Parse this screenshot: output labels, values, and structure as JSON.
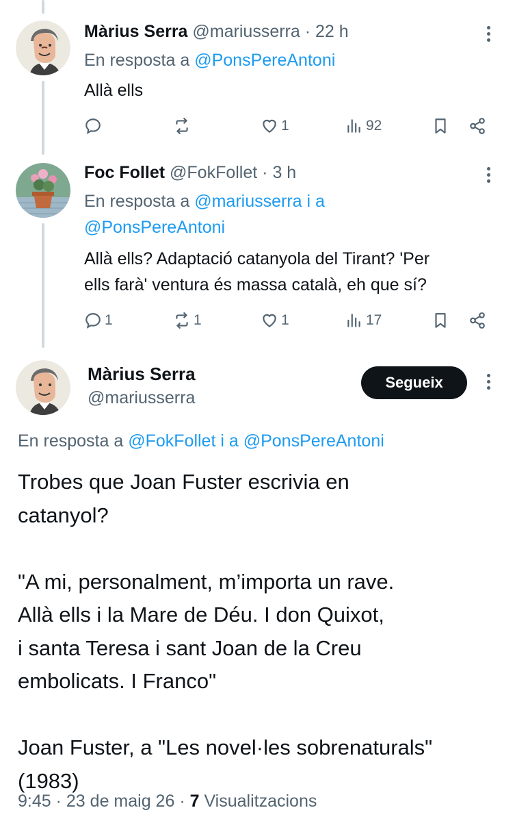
{
  "tweets": [
    {
      "author": "Màrius Serra",
      "handle": "@mariusserra",
      "time": "22 h",
      "reply_prefix": "En resposta a",
      "reply_mention": "@PonsPereAntoni",
      "text": "Allà ells",
      "actions": {
        "replies": "",
        "retweets": "",
        "likes": "1",
        "views": "92"
      }
    },
    {
      "author": "Foc Follet",
      "handle": "@FokFollet",
      "time": "3 h",
      "reply_prefix": "En resposta a",
      "reply_mention_1": "@mariusserra",
      "reply_conj": "i a",
      "reply_mention_2": "@PonsPereAntoni",
      "text_line_1": "Allà ells? Adaptació catanyola del Tirant? 'Per",
      "text_line_2": "ells farà' ventura és massa català, eh que sí?",
      "actions": {
        "replies": "1",
        "retweets": "1",
        "likes": "1",
        "views": "17"
      }
    }
  ],
  "main": {
    "author": "Màrius Serra",
    "handle": "@mariusserra",
    "follow_label": "Segueix",
    "reply_prefix": "En resposta a",
    "reply_mention_1": "@FokFollet",
    "reply_conj": "i a",
    "reply_mention_2": "@PonsPereAntoni",
    "paragraph_1": "Trobes que Joan Fuster escrivia en\ncatanyol?",
    "paragraph_2": "\"A mi, personalment, m’importa un rave.\nAllà ells i la Mare de Déu. I don Quixot,\ni santa Teresa i sant Joan de la Creu\nembolicats. I Franco\"",
    "paragraph_3": "Joan Fuster, a \"Les novel·les sobrenaturals\"\n(1983)",
    "time": "9:45",
    "date": "23 de maig 26",
    "views_count": "7",
    "views_label": "Visualitzacions"
  },
  "colors": {
    "text": "#0f1419",
    "muted": "#536471",
    "link": "#1d9bf0",
    "line": "#cfd9de",
    "button": "#0f1419"
  },
  "icons": [
    "reply-icon",
    "retweet-icon",
    "like-icon",
    "views-icon",
    "bookmark-icon",
    "share-icon",
    "more-icon"
  ]
}
